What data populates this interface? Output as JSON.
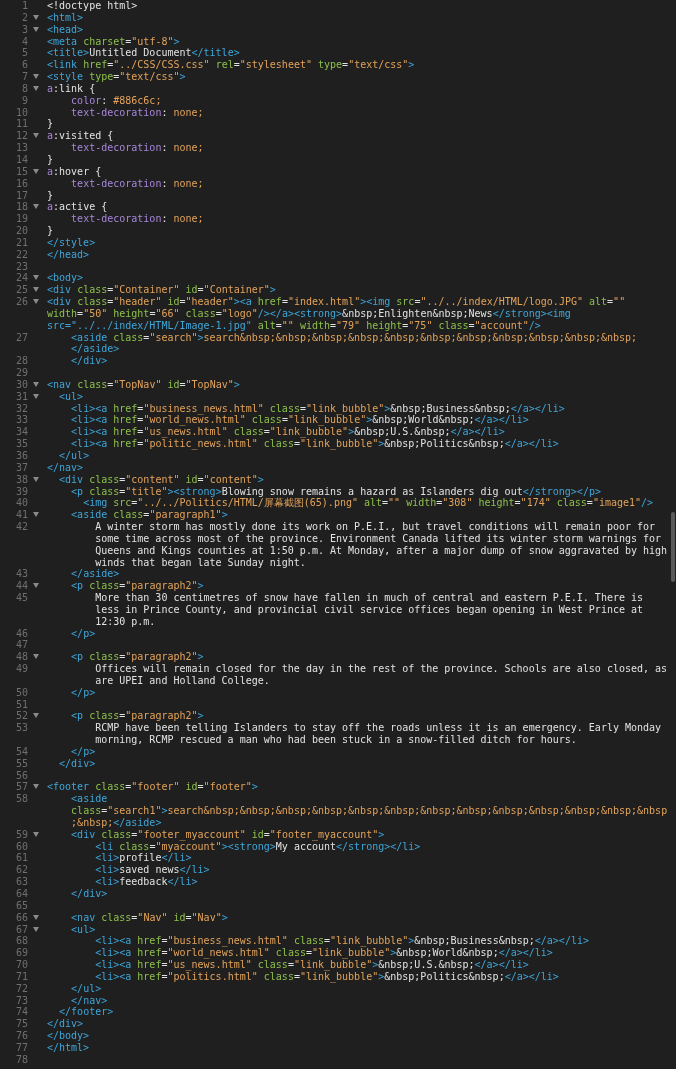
{
  "editor": {
    "lines": [
      {
        "number": "1",
        "fold": false,
        "kind": "html",
        "rows": [
          "<!doctype html>"
        ]
      },
      {
        "number": "2",
        "fold": true,
        "kind": "html",
        "rows": [
          "<html>"
        ]
      },
      {
        "number": "3",
        "fold": true,
        "kind": "html",
        "rows": [
          "<head>"
        ]
      },
      {
        "number": "4",
        "fold": false,
        "kind": "html",
        "rows": [
          "<meta charset=\"utf-8\">"
        ]
      },
      {
        "number": "5",
        "fold": false,
        "kind": "html",
        "rows": [
          "<title>Untitled Document</title>"
        ]
      },
      {
        "number": "6",
        "fold": false,
        "kind": "html",
        "rows": [
          "<link href=\"../CSS/CSS.css\" rel=\"stylesheet\" type=\"text/css\">"
        ]
      },
      {
        "number": "7",
        "fold": true,
        "kind": "html",
        "rows": [
          "<style type=\"text/css\">"
        ]
      },
      {
        "number": "8",
        "fold": true,
        "kind": "css",
        "rows": [
          "a:link {"
        ]
      },
      {
        "number": "9",
        "fold": false,
        "kind": "css",
        "rows": [
          "    color: #886c6c;"
        ]
      },
      {
        "number": "10",
        "fold": false,
        "kind": "css",
        "rows": [
          "    text-decoration: none;"
        ]
      },
      {
        "number": "11",
        "fold": false,
        "kind": "css",
        "rows": [
          "}"
        ]
      },
      {
        "number": "12",
        "fold": true,
        "kind": "css",
        "rows": [
          "a:visited {"
        ]
      },
      {
        "number": "13",
        "fold": false,
        "kind": "css",
        "rows": [
          "    text-decoration: none;"
        ]
      },
      {
        "number": "14",
        "fold": false,
        "kind": "css",
        "rows": [
          "}"
        ]
      },
      {
        "number": "15",
        "fold": true,
        "kind": "css",
        "rows": [
          "a:hover {"
        ]
      },
      {
        "number": "16",
        "fold": false,
        "kind": "css",
        "rows": [
          "    text-decoration: none;"
        ]
      },
      {
        "number": "17",
        "fold": false,
        "kind": "css",
        "rows": [
          "}"
        ]
      },
      {
        "number": "18",
        "fold": true,
        "kind": "css",
        "rows": [
          "a:active {"
        ]
      },
      {
        "number": "19",
        "fold": false,
        "kind": "css",
        "rows": [
          "    text-decoration: none;"
        ]
      },
      {
        "number": "20",
        "fold": false,
        "kind": "css",
        "rows": [
          "}"
        ]
      },
      {
        "number": "21",
        "fold": false,
        "kind": "html",
        "rows": [
          "</style>"
        ]
      },
      {
        "number": "22",
        "fold": false,
        "kind": "html",
        "rows": [
          "</head>"
        ]
      },
      {
        "number": "23",
        "fold": false
      },
      {
        "number": "24",
        "fold": true,
        "kind": "html",
        "rows": [
          "<body>"
        ]
      },
      {
        "number": "25",
        "fold": true,
        "kind": "html",
        "rows": [
          "<div class=\"Container\" id=\"Container\">"
        ]
      },
      {
        "number": "26",
        "fold": true,
        "kind": "html",
        "rows": [
          "<div class=\"header\" id=\"header\"><a href=\"index.html\"><img src=\"../../index/HTML/logo.JPG\" alt=\"\"",
          "width=\"50\" height=\"66\" class=\"logo\"/></a><strong>&nbsp;Enlighten&nbsp;News</strong><img",
          "src=\"../../index/HTML/Image-1.jpg\" alt=\"\" width=\"79\" height=\"75\" class=\"account\"/>"
        ]
      },
      {
        "number": "27",
        "fold": false,
        "kind": "html-quoted",
        "rows": [
          "    <aside class=\"search\">search&nbsp;&nbsp;&nbsp;&nbsp;&nbsp;&nbsp;&nbsp;&nbsp;&nbsp;&nbsp;&nbsp;",
          "    </aside>"
        ]
      },
      {
        "number": "28",
        "fold": false,
        "kind": "html",
        "rows": [
          "    </div>"
        ]
      },
      {
        "number": "29",
        "fold": false
      },
      {
        "number": "30",
        "fold": true,
        "kind": "html",
        "rows": [
          "<nav class=\"TopNav\" id=\"TopNav\">"
        ]
      },
      {
        "number": "31",
        "fold": true,
        "kind": "html",
        "rows": [
          "  <ul>"
        ]
      },
      {
        "number": "32",
        "fold": false,
        "kind": "html",
        "rows": [
          "    <li><a href=\"business_news.html\" class=\"link_bubble\">&nbsp;Business&nbsp;</a></li>"
        ]
      },
      {
        "number": "33",
        "fold": false,
        "kind": "html",
        "rows": [
          "    <li><a href=\"world_news.html\" class=\"link_bubble\">&nbsp;World&nbsp;</a></li>"
        ]
      },
      {
        "number": "34",
        "fold": false,
        "kind": "html",
        "rows": [
          "    <li><a href=\"us_news.html\" class=\"link_bubble\">&nbsp;U.S.&nbsp;</a></li>"
        ]
      },
      {
        "number": "35",
        "fold": false,
        "kind": "html",
        "rows": [
          "    <li><a href=\"politic_news.html\" class=\"link_bubble\">&nbsp;Politics&nbsp;</a></li>"
        ]
      },
      {
        "number": "36",
        "fold": false,
        "kind": "html",
        "rows": [
          "  </ul>"
        ]
      },
      {
        "number": "37",
        "fold": false,
        "kind": "html",
        "rows": [
          "</nav>"
        ]
      },
      {
        "number": "38",
        "fold": true,
        "kind": "html",
        "rows": [
          "  <div class=\"content\" id=\"content\">"
        ]
      },
      {
        "number": "39",
        "fold": false,
        "kind": "html",
        "rows": [
          "    <p class=\"title\"><strong>Blowing snow remains a hazard as Islanders dig out</strong></p>"
        ]
      },
      {
        "number": "40",
        "fold": false,
        "kind": "html",
        "rows": [
          "      <img src=\"../../Politics/HTML/屏幕截图(65).png\" alt=\"\" width=\"308\" height=\"174\" class=\"image1\"/>"
        ]
      },
      {
        "number": "41",
        "fold": true,
        "kind": "html",
        "rows": [
          "    <aside class=\"paragraph1\">"
        ]
      },
      {
        "number": "42",
        "fold": false,
        "kind": "html",
        "rows": [
          "        A winter storm has mostly done its work on P.E.I., but travel conditions will remain poor for",
          "        some time across most of the province. Environment Canada lifted its winter storm warnings for",
          "        Queens and Kings counties at 1:50 p.m. At Monday, after a major dump of snow aggravated by high",
          "        winds that began late Sunday night."
        ]
      },
      {
        "number": "43",
        "fold": false,
        "kind": "html",
        "rows": [
          "    </aside>"
        ]
      },
      {
        "number": "44",
        "fold": true,
        "kind": "html",
        "rows": [
          "    <p class=\"paragraph2\">"
        ]
      },
      {
        "number": "45",
        "fold": false,
        "kind": "html",
        "rows": [
          "        More than 30 centimetres of snow have fallen in much of central and eastern P.E.I. There is",
          "        less in Prince County, and provincial civil service offices began opening in West Prince at",
          "        12:30 p.m."
        ]
      },
      {
        "number": "46",
        "fold": false,
        "kind": "html",
        "rows": [
          "    </p>"
        ]
      },
      {
        "number": "47",
        "fold": false
      },
      {
        "number": "48",
        "fold": true,
        "kind": "html",
        "rows": [
          "    <p class=\"paragraph2\">"
        ]
      },
      {
        "number": "49",
        "fold": false,
        "kind": "html",
        "rows": [
          "        Offices will remain closed for the day in the rest of the province. Schools are also closed, as",
          "        are UPEI and Holland College."
        ]
      },
      {
        "number": "50",
        "fold": false,
        "kind": "html",
        "rows": [
          "    </p>"
        ]
      },
      {
        "number": "51",
        "fold": false
      },
      {
        "number": "52",
        "fold": true,
        "kind": "html",
        "rows": [
          "    <p class=\"paragraph2\">"
        ]
      },
      {
        "number": "53",
        "fold": false,
        "kind": "html",
        "rows": [
          "        RCMP have been telling Islanders to stay off the roads unless it is an emergency. Early Monday",
          "        morning, RCMP rescued a man who had been stuck in a snow-filled ditch for hours."
        ]
      },
      {
        "number": "54",
        "fold": false,
        "kind": "html",
        "rows": [
          "    </p>"
        ]
      },
      {
        "number": "55",
        "fold": false,
        "kind": "html",
        "rows": [
          "  </div>"
        ]
      },
      {
        "number": "56",
        "fold": false
      },
      {
        "number": "57",
        "fold": true,
        "kind": "html",
        "rows": [
          "<footer class=\"footer\" id=\"footer\">"
        ]
      },
      {
        "number": "58",
        "fold": false,
        "kind": "html-quoted",
        "rows": [
          "    <aside",
          "    class=\"search1\">search&nbsp;&nbsp;&nbsp;&nbsp;&nbsp;&nbsp;&nbsp;&nbsp;&nbsp;&nbsp;&nbsp;&nbsp;&nbsp",
          "    ;&nbsp;</aside>"
        ]
      },
      {
        "number": "59",
        "fold": true,
        "kind": "html",
        "rows": [
          "    <div class=\"footer_myaccount\" id=\"footer_myaccount\">"
        ]
      },
      {
        "number": "60",
        "fold": false,
        "kind": "html",
        "rows": [
          "        <li class=\"myaccount\"><strong>My account</strong></li>"
        ]
      },
      {
        "number": "61",
        "fold": false,
        "kind": "html",
        "rows": [
          "        <li>profile</li>"
        ]
      },
      {
        "number": "62",
        "fold": false,
        "kind": "html",
        "rows": [
          "        <li>saved news</li>"
        ]
      },
      {
        "number": "63",
        "fold": false,
        "kind": "html",
        "rows": [
          "        <li>feedback</li>"
        ]
      },
      {
        "number": "64",
        "fold": false,
        "kind": "html",
        "rows": [
          "    </div>"
        ]
      },
      {
        "number": "65",
        "fold": false
      },
      {
        "number": "66",
        "fold": true,
        "kind": "html",
        "rows": [
          "    <nav class=\"Nav\" id=\"Nav\">"
        ]
      },
      {
        "number": "67",
        "fold": true,
        "kind": "html",
        "rows": [
          "    <ul>"
        ]
      },
      {
        "number": "68",
        "fold": false,
        "kind": "html",
        "rows": [
          "        <li><a href=\"business_news.html\" class=\"link_bubble\">&nbsp;Business&nbsp;</a></li>"
        ]
      },
      {
        "number": "69",
        "fold": false,
        "kind": "html",
        "rows": [
          "        <li><a href=\"world_news.html\" class=\"link_bubble\">&nbsp;World&nbsp;</a></li>"
        ]
      },
      {
        "number": "70",
        "fold": false,
        "kind": "html",
        "rows": [
          "        <li><a href=\"us_news.html\" class=\"link_bubble\">&nbsp;U.S.&nbsp;</a></li>"
        ]
      },
      {
        "number": "71",
        "fold": false,
        "kind": "html",
        "rows": [
          "        <li><a href=\"politics.html\" class=\"link_bubble\">&nbsp;Politics&nbsp;</a></li>"
        ]
      },
      {
        "number": "72",
        "fold": false,
        "kind": "html",
        "rows": [
          "    </ul>"
        ]
      },
      {
        "number": "73",
        "fold": false,
        "kind": "html",
        "rows": [
          "    </nav>"
        ]
      },
      {
        "number": "74",
        "fold": false,
        "kind": "html",
        "rows": [
          "  </footer>"
        ]
      },
      {
        "number": "75",
        "fold": false,
        "kind": "html",
        "rows": [
          "</div>"
        ]
      },
      {
        "number": "76",
        "fold": false,
        "kind": "html",
        "rows": [
          "</body>"
        ]
      },
      {
        "number": "77",
        "fold": false,
        "kind": "html",
        "rows": [
          "</html>"
        ]
      },
      {
        "number": "78",
        "fold": false
      }
    ]
  }
}
